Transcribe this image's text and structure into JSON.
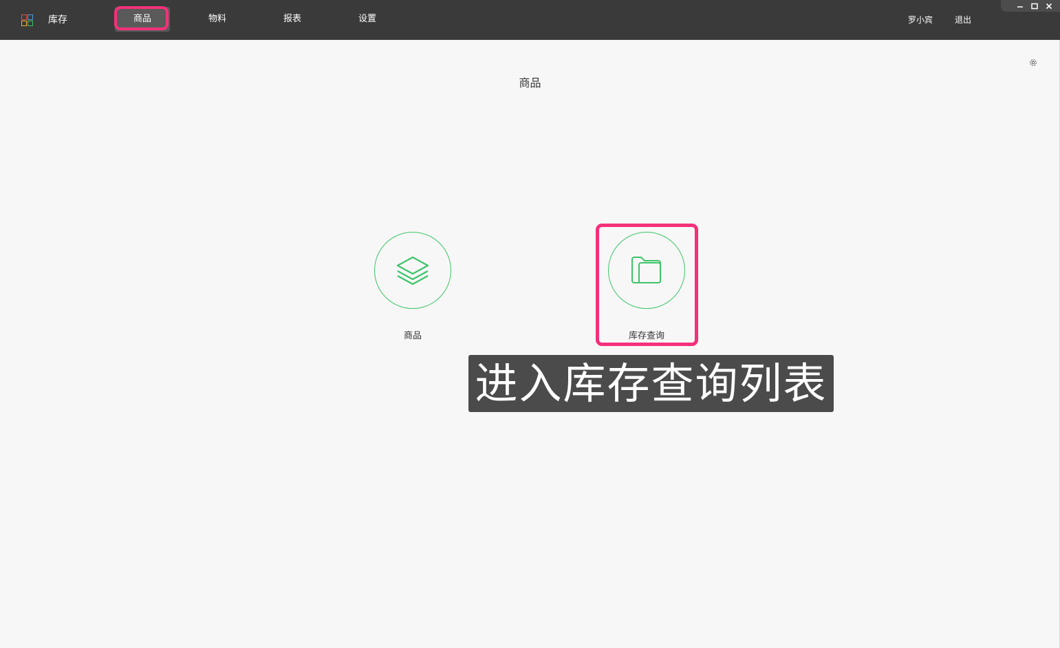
{
  "app": {
    "title": "库存",
    "icon": "grid-apps-icon"
  },
  "nav": {
    "items": [
      {
        "label": "商品",
        "active": true
      },
      {
        "label": "物料",
        "active": false
      },
      {
        "label": "报表",
        "active": false
      },
      {
        "label": "设置",
        "active": false
      }
    ]
  },
  "user": {
    "name": "罗小宾",
    "logout_label": "退出"
  },
  "window_controls": [
    "minimize-icon",
    "maximize-icon",
    "close-icon"
  ],
  "page": {
    "title": "商品"
  },
  "tiles": [
    {
      "label": "商品",
      "icon": "layers-icon"
    },
    {
      "label": "库存查询",
      "icon": "folder-icon"
    }
  ],
  "caption": {
    "text": "进入库存查询列表"
  },
  "colors": {
    "topbar": "#3a3a3a",
    "accent_green": "#3cc468",
    "highlight_pink": "#f5307a",
    "caption_bg": "#4b4b4b",
    "background": "#f7f7f7"
  }
}
